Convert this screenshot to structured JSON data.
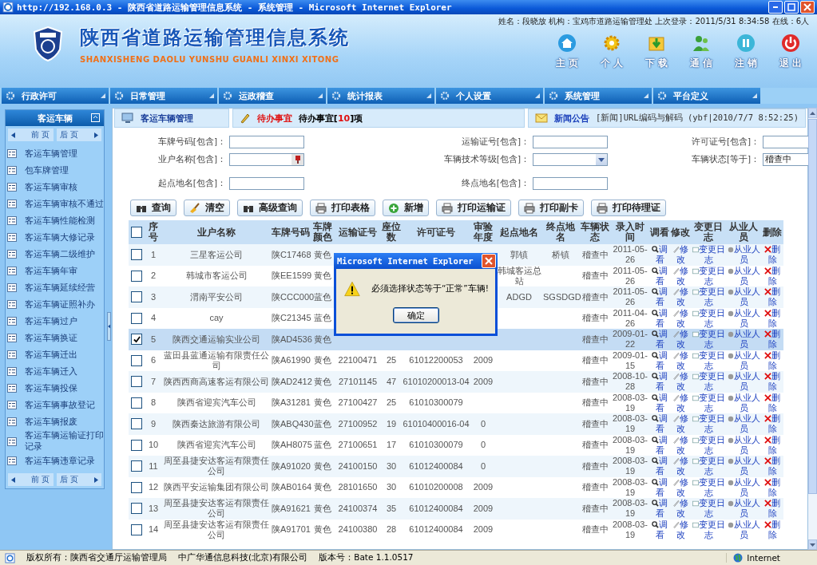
{
  "window": {
    "title": "http://192.168.0.3 - 陕西省道路运输管理信息系统 - 系统管理 - Microsoft Internet Explorer"
  },
  "header": {
    "title": "陕西省道路运输管理信息系统",
    "subtitle": "SHANXISHENG DAOLU YUNSHU GUANLI XINXI XITONG",
    "user_info": "姓名：段晓放 机构：宝鸡市道路运输管理处 上次登录：2011/5/31 8:34:58 在线：6人"
  },
  "toolbar_buttons": [
    {
      "label": "主 页",
      "kind": "home"
    },
    {
      "label": "个 人",
      "kind": "gear"
    },
    {
      "label": "下 载",
      "kind": "download"
    },
    {
      "label": "通 信",
      "kind": "users"
    },
    {
      "label": "注 销",
      "kind": "pause"
    },
    {
      "label": "退 出",
      "kind": "power"
    }
  ],
  "menu": [
    "行政许可",
    "日常管理",
    "运政稽查",
    "统计报表",
    "个人设置",
    "系统管理",
    "平台定义"
  ],
  "sidebar": {
    "title": "客运车辆",
    "pager_top": {
      "prev": "前 页",
      "next": "后 页"
    },
    "pager_bottom": {
      "prev": "前 页",
      "next": "后 页"
    },
    "items": [
      "客运车辆管理",
      "包车牌管理",
      "客运车辆审核",
      "客运车辆审核不通过",
      "客运车辆性能检测",
      "客运车辆大修记录",
      "客运车辆二级维护",
      "客运车辆年审",
      "客运车辆延续经营",
      "客运车辆证照补办",
      "客运车辆过户",
      "客运车辆换证",
      "客运车辆迁出",
      "客运车辆迁入",
      "客运车辆投保",
      "客运车辆事故登记",
      "客运车辆报废",
      "客运车辆运输证打印记录",
      "客运车辆违章记录"
    ]
  },
  "panel_header": {
    "module": "客运车辆管理",
    "todo_label": "待办事宜",
    "todo_text": "待办事宜[**10**]项",
    "news_label": "新闻公告",
    "news_text": "[新闻]URL编码与解码 (ybf|2010/7/7 8:52:25)"
  },
  "filters": [
    {
      "label": "车牌号码[包含]：",
      "kind": "text"
    },
    {
      "label": "运输证号[包含]：",
      "kind": "text"
    },
    {
      "label": "许可证号[包含]：",
      "kind": "text"
    },
    {
      "label": "业户名称[包含]：",
      "kind": "picker"
    },
    {
      "label": "车辆技术等级[包含]：",
      "kind": "select"
    },
    {
      "label": "车辆状态[等于]：",
      "kind": "select",
      "value": "稽查中"
    },
    {
      "label": "起点地名[包含]：",
      "kind": "text"
    },
    {
      "label": "终点地名[包含]：",
      "kind": "text"
    }
  ],
  "actions": [
    {
      "label": "查询",
      "kind": "binoculars"
    },
    {
      "label": "清空",
      "kind": "broom"
    },
    {
      "label": "高级查询",
      "kind": "binoculars"
    },
    {
      "label": "打印表格",
      "kind": "printer"
    },
    {
      "label": "新增",
      "kind": "add"
    },
    {
      "label": "打印运输证",
      "kind": "printer"
    },
    {
      "label": "打印副卡",
      "kind": "printer"
    },
    {
      "label": "打印待理证",
      "kind": "printer"
    }
  ],
  "table": {
    "all_checked": false,
    "columns": [
      "序号",
      "业户名称",
      "车牌号码",
      "车牌颜色",
      "运输证号",
      "座位数",
      "许可证号",
      "审验年度",
      "起点地名",
      "终点地名",
      "车辆状态",
      "录入时间",
      "调看",
      "修改",
      "变更日志",
      "从业人员",
      "删除"
    ],
    "rows": [
      {
        "selected": false,
        "cells": [
          "1",
          "三星客运公司",
          "陕C17468",
          "黄色",
          null,
          null,
          null,
          null,
          "郭镇",
          "桥镇",
          "稽查中",
          "2011-05-26"
        ],
        "links": [
          "调看",
          "修改",
          "变更日志",
          "从业人员",
          "删除"
        ]
      },
      {
        "selected": false,
        "cells": [
          "2",
          "韩城市客运公司",
          "陕EE1599",
          "黄色",
          null,
          null,
          null,
          null,
          "韩城客运总站",
          null,
          "稽查中",
          "2011-05-26"
        ],
        "links": [
          "调看",
          "修改",
          "变更日志",
          "从业人员",
          "删除"
        ]
      },
      {
        "selected": false,
        "cells": [
          "3",
          "渭南平安公司",
          "陕CCC000",
          "蓝色",
          null,
          null,
          null,
          null,
          "ADGD",
          "SGSDGD",
          "稽查中",
          "2011-05-26"
        ],
        "links": [
          "调看",
          "修改",
          "变更日志",
          "从业人员",
          "删除"
        ]
      },
      {
        "selected": false,
        "cells": [
          "4",
          "cay",
          "陕C21345",
          "蓝色",
          null,
          null,
          null,
          null,
          null,
          null,
          "稽查中",
          "2011-04-26"
        ],
        "links": [
          "调看",
          "修改",
          "变更日志",
          "从业人员",
          "删除"
        ]
      },
      {
        "selected": true,
        "cells": [
          "5",
          "陕西交通运输实业公司",
          "陕AD4536",
          "黄色",
          null,
          null,
          null,
          null,
          null,
          null,
          "稽查中",
          "2009-01-22"
        ],
        "links": [
          "调看",
          "修改",
          "变更日志",
          "从业人员",
          "删除"
        ]
      },
      {
        "selected": false,
        "cells": [
          "6",
          "蓝田县蓝通运输有限责任公司",
          "陕A61990",
          "黄色",
          "22100471",
          "25",
          "61012200053",
          "2009",
          null,
          null,
          "稽查中",
          "2009-01-15"
        ],
        "links": [
          "调看",
          "修改",
          "变更日志",
          "从业人员",
          "删除"
        ]
      },
      {
        "selected": false,
        "cells": [
          "7",
          "陕西西商高速客运有限公司",
          "陕AD2412",
          "黄色",
          "27101145",
          "47",
          "61010200013-04",
          "2009",
          null,
          null,
          "稽查中",
          "2008-10-28"
        ],
        "links": [
          "调看",
          "修改",
          "变更日志",
          "从业人员",
          "删除"
        ]
      },
      {
        "selected": false,
        "cells": [
          "8",
          "陕西省迎宾汽车公司",
          "陕A31281",
          "黄色",
          "27100427",
          "25",
          "61010300079",
          null,
          null,
          null,
          "稽查中",
          "2008-03-19"
        ],
        "links": [
          "调看",
          "修改",
          "变更日志",
          "从业人员",
          "删除"
        ]
      },
      {
        "selected": false,
        "cells": [
          "9",
          "陕西秦达旅游有限公司",
          "陕ABQ430",
          "蓝色",
          "27100952",
          "19",
          "61010400016-04",
          "0",
          null,
          null,
          "稽查中",
          "2008-03-19"
        ],
        "links": [
          "调看",
          "修改",
          "变更日志",
          "从业人员",
          "删除"
        ]
      },
      {
        "selected": false,
        "cells": [
          "10",
          "陕西省迎宾汽车公司",
          "陕AH8075",
          "蓝色",
          "27100651",
          "17",
          "61010300079",
          "0",
          null,
          null,
          "稽查中",
          "2008-03-19"
        ],
        "links": [
          "调看",
          "修改",
          "变更日志",
          "从业人员",
          "删除"
        ]
      },
      {
        "selected": false,
        "cells": [
          "11",
          "周至县捷安达客运有限责任公司",
          "陕A91020",
          "黄色",
          "24100150",
          "30",
          "61012400084",
          "0",
          null,
          null,
          "稽查中",
          "2008-03-19"
        ],
        "links": [
          "调看",
          "修改",
          "变更日志",
          "从业人员",
          "删除"
        ]
      },
      {
        "selected": false,
        "cells": [
          "12",
          "陕西平安运输集团有限公司",
          "陕AB0164",
          "黄色",
          "28101650",
          "30",
          "61010200008",
          "2009",
          null,
          null,
          "稽查中",
          "2008-03-19"
        ],
        "links": [
          "调看",
          "修改",
          "变更日志",
          "从业人员",
          "删除"
        ]
      },
      {
        "selected": false,
        "cells": [
          "13",
          "周至县捷安达客运有限责任公司",
          "陕A91621",
          "黄色",
          "24100374",
          "35",
          "61012400084",
          "2009",
          null,
          null,
          "稽查中",
          "2008-03-19"
        ],
        "links": [
          "调看",
          "修改",
          "变更日志",
          "从业人员",
          "删除"
        ]
      },
      {
        "selected": false,
        "cells": [
          "14",
          "周至县捷安达客运有限责任公司",
          "陕A91701",
          "黄色",
          "24100380",
          "28",
          "61012400084",
          "2009",
          null,
          null,
          "稽查中",
          "2008-03-19"
        ],
        "links": [
          "调看",
          "修改",
          "变更日志",
          "从业人员",
          "删除"
        ]
      }
    ]
  },
  "dialog": {
    "title": "Microsoft Internet Explorer",
    "message": "必须选择状态等于“正常”车辆!",
    "button": "确定"
  },
  "status_bar": {
    "copyright": "版权所有：陕西省交通厅运输管理局",
    "company": "中广华通信息科技(北京)有限公司",
    "version": "版本号：Bate 1.1.0517",
    "zone": "Internet"
  }
}
